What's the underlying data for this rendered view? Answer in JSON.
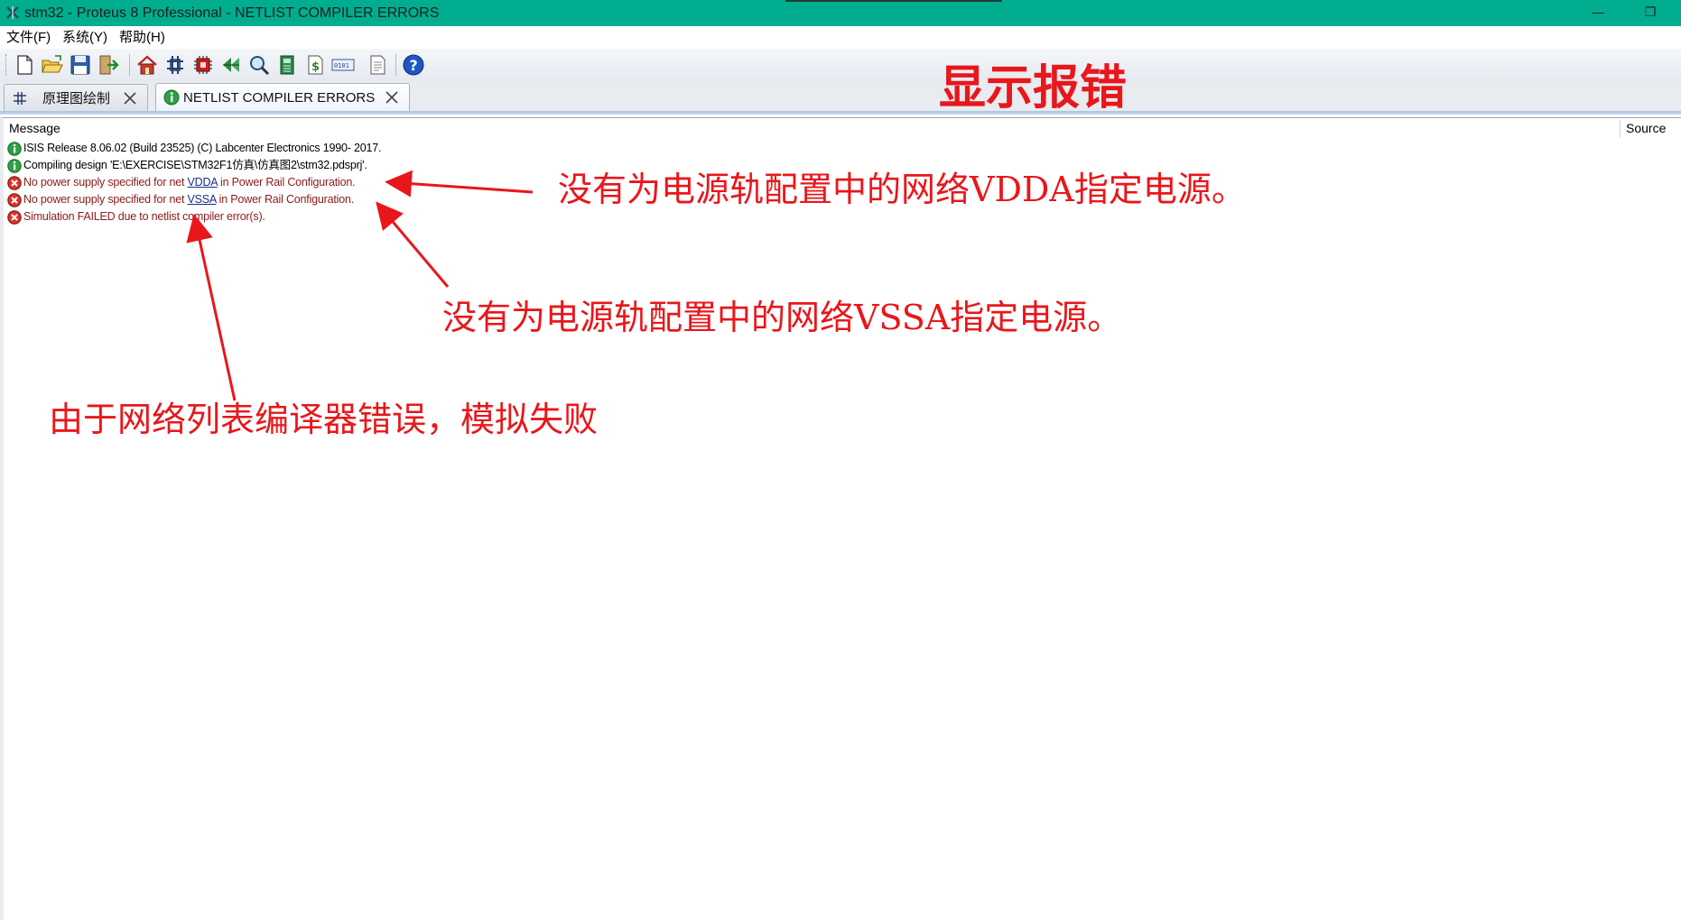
{
  "window": {
    "title": "stm32 - Proteus 8 Professional - NETLIST COMPILER ERRORS",
    "minimize_glyph": "—",
    "restore_glyph": "❐"
  },
  "menu": {
    "items": [
      {
        "label": "文件(F)"
      },
      {
        "label": "系统(Y)"
      },
      {
        "label": "帮助(H)"
      }
    ]
  },
  "toolbar": {
    "buttons": [
      {
        "name": "new-project-icon"
      },
      {
        "name": "open-project-icon"
      },
      {
        "name": "save-project-icon"
      },
      {
        "name": "close-project-icon"
      },
      {
        "name": "home-page-icon"
      },
      {
        "name": "schematic-capture-icon"
      },
      {
        "name": "pcb-layout-icon"
      },
      {
        "name": "gerber-viewer-icon"
      },
      {
        "name": "design-explorer-icon"
      },
      {
        "name": "3d-visualizer-icon"
      },
      {
        "name": "bill-of-materials-icon"
      },
      {
        "name": "source-code-icon"
      },
      {
        "name": "project-notes-icon"
      },
      {
        "name": "help-icon"
      }
    ]
  },
  "tabs": [
    {
      "label": "原理图绘制",
      "icon": "schematic-icon",
      "active": false
    },
    {
      "label": "NETLIST COMPILER ERRORS",
      "icon": "info-icon",
      "active": true
    }
  ],
  "table": {
    "headers": {
      "message": "Message",
      "source": "Source"
    },
    "rows": [
      {
        "type": "info",
        "parts": [
          "ISIS Release 8.06.02 (Build 23525) (C) Labcenter Electronics 1990- 2017."
        ]
      },
      {
        "type": "info",
        "parts": [
          "Compiling design 'E:\\EXERCISE\\STM32F1仿真\\仿真图2\\stm32.pdsprj'."
        ]
      },
      {
        "type": "error",
        "pre": "No power supply specified for net ",
        "link": "VDDA",
        "post": " in Power Rail Configuration."
      },
      {
        "type": "error",
        "pre": "No power supply specified for net ",
        "link": "VSSA",
        "post": " in Power Rail Configuration."
      },
      {
        "type": "error",
        "parts": [
          "Simulation FAILED due to netlist compiler error(s)."
        ]
      }
    ]
  },
  "annotations": {
    "title": "显示报错",
    "vdda": "没有为电源轨配置中的网络VDDA指定电源。",
    "vssa": "没有为电源轨配置中的网络VSSA指定电源。",
    "failed": "由于网络列表编译器错误，模拟失败"
  },
  "colors": {
    "titlebar": "#00ad8f",
    "annotation_red": "#e8171b",
    "error_text": "#8b1a1a",
    "link_blue": "#1a2b8c"
  }
}
